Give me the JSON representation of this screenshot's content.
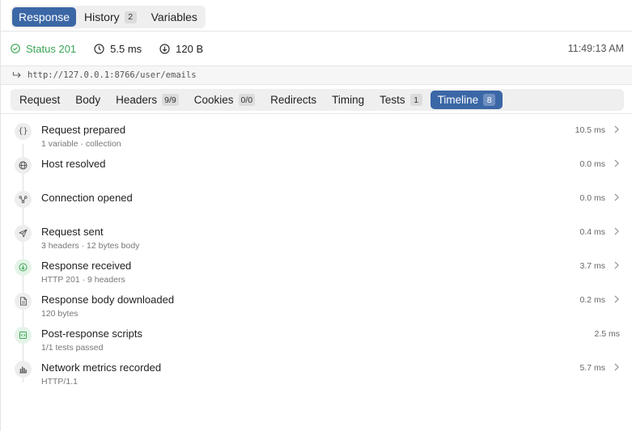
{
  "top_tabs": [
    {
      "label": "Response",
      "badge": null,
      "active": true
    },
    {
      "label": "History",
      "badge": "2",
      "active": false
    },
    {
      "label": "Variables",
      "badge": null,
      "active": false
    }
  ],
  "status": {
    "status_text": "Status 201",
    "duration": "5.5 ms",
    "size": "120 B",
    "time": "11:49:13 AM",
    "status_color": "#3aa655"
  },
  "url": "http://127.0.0.1:8766/user/emails",
  "sub_tabs": [
    {
      "label": "Request",
      "badge": null
    },
    {
      "label": "Body",
      "badge": null
    },
    {
      "label": "Headers",
      "badge": "9/9"
    },
    {
      "label": "Cookies",
      "badge": "0/0"
    },
    {
      "label": "Redirects",
      "badge": null
    },
    {
      "label": "Timing",
      "badge": null
    },
    {
      "label": "Tests",
      "badge": "1"
    },
    {
      "label": "Timeline",
      "badge": "8",
      "active": true
    }
  ],
  "timeline": [
    {
      "icon": "braces-icon",
      "title": "Request prepared",
      "subtitle": "1 variable · collection",
      "duration": "10.5 ms",
      "chevron": true
    },
    {
      "icon": "globe-icon",
      "title": "Host resolved",
      "subtitle": "",
      "duration": "0.0 ms",
      "chevron": true
    },
    {
      "icon": "network-icon",
      "title": "Connection opened",
      "subtitle": "",
      "duration": "0.0 ms",
      "chevron": true
    },
    {
      "icon": "send-icon",
      "title": "Request sent",
      "subtitle": "3 headers · 12 bytes body",
      "duration": "0.4 ms",
      "chevron": true
    },
    {
      "icon": "download-icon",
      "title": "Response received",
      "subtitle": "HTTP 201 · 9 headers",
      "duration": "3.7 ms",
      "chevron": true
    },
    {
      "icon": "file-icon",
      "title": "Response body downloaded",
      "subtitle": "120 bytes",
      "duration": "0.2 ms",
      "chevron": true
    },
    {
      "icon": "script-icon",
      "title": "Post-response scripts",
      "subtitle": "1/1 tests passed",
      "duration": "2.5 ms",
      "chevron": false
    },
    {
      "icon": "bar-chart-icon",
      "title": "Network metrics recorded",
      "subtitle": "HTTP/1.1",
      "duration": "5.7 ms",
      "chevron": true
    }
  ],
  "colors": {
    "accent": "#3b67a6",
    "success": "#3aa655"
  }
}
